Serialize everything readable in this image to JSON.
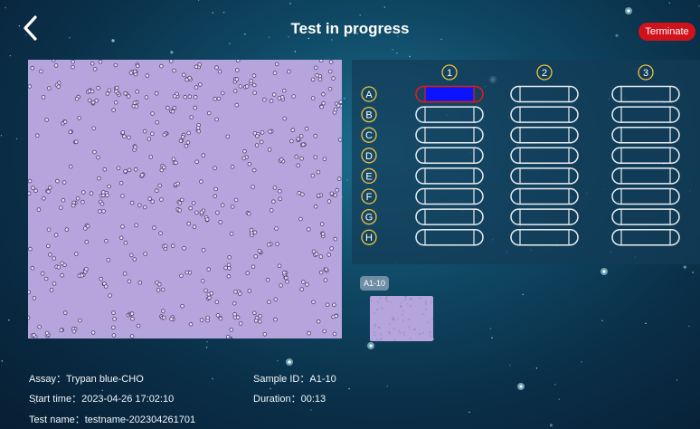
{
  "header": {
    "title": "Test in progress",
    "terminate_label": "Terminate",
    "back_icon": "chevron-left-icon"
  },
  "plate": {
    "columns": [
      "1",
      "2",
      "3"
    ],
    "rows": [
      "A",
      "B",
      "C",
      "D",
      "E",
      "F",
      "G",
      "H"
    ],
    "active_well": {
      "column": "1",
      "row": "A"
    },
    "active_fill_color": "#0a14ff",
    "active_border_color": "#e01a1a"
  },
  "thumbnail": {
    "label": "A1-10"
  },
  "info": {
    "assay_label": "Assay：",
    "assay_value": "Trypan blue-CHO",
    "start_label": "Start time：",
    "start_value": "2023-04-26 17:02:10",
    "testname_label": "Test name：",
    "testname_value": "testname-202304261701",
    "sample_label": "Sample ID：",
    "sample_value": "A1-10",
    "duration_label": "Duration：",
    "duration_value": "00:13"
  },
  "colors": {
    "terminate_button": "#d0121b",
    "image_background": "#b6a4dc"
  }
}
